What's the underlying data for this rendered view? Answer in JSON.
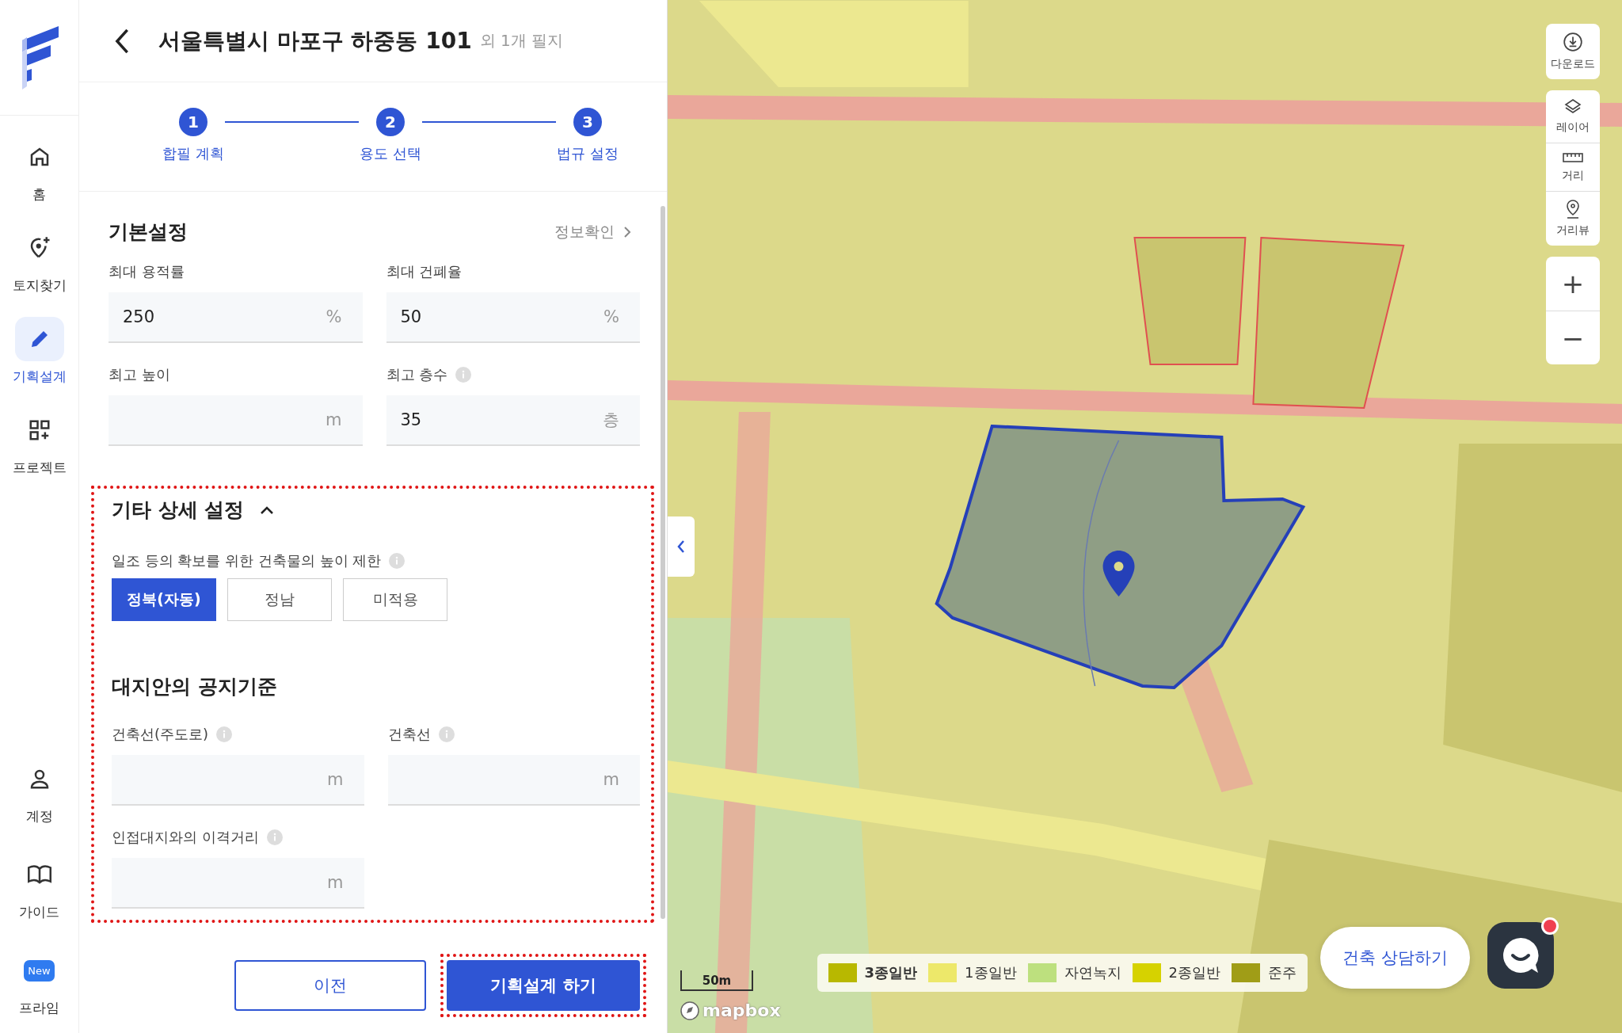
{
  "sidebar": {
    "nav_items": [
      {
        "label": "홈",
        "selected": false
      },
      {
        "label": "토지찾기",
        "selected": false
      },
      {
        "label": "기획설계",
        "selected": true
      },
      {
        "label": "프로젝트",
        "selected": false
      }
    ],
    "bottom_items": [
      {
        "label": "계정"
      },
      {
        "label": "가이드"
      },
      {
        "label": "프라임",
        "badge": "New"
      }
    ]
  },
  "header": {
    "title": "서울특별시 마포구 하중동 101",
    "suffix": "외 1개 필지"
  },
  "stepper": [
    {
      "number": "1",
      "label": "합필 계획"
    },
    {
      "number": "2",
      "label": "용도 선택"
    },
    {
      "number": "3",
      "label": "법규 설정"
    }
  ],
  "basic_settings": {
    "title": "기본설정",
    "link": "정보확인",
    "fields": [
      {
        "label": "최대 용적률",
        "value": "250",
        "unit": "%",
        "info": false
      },
      {
        "label": "최대 건폐율",
        "value": "50",
        "unit": "%",
        "info": false
      },
      {
        "label": "최고 높이",
        "unit": "m",
        "info": false
      },
      {
        "label": "최고 층수",
        "value": "35",
        "unit": "층",
        "info": true
      }
    ]
  },
  "detail_settings": {
    "title": "기타 상세 설정",
    "expanded": true,
    "highlighted": true,
    "sunlight": {
      "label": "일조 등의 확보를 위한 건축물의 높이 제한",
      "info": true,
      "options": [
        {
          "label": "정북(자동)",
          "selected": true
        },
        {
          "label": "정남",
          "selected": false
        },
        {
          "label": "미적용",
          "selected": false
        }
      ]
    },
    "open_space": {
      "title": "대지안의 공지기준",
      "fields": [
        {
          "label": "건축선(주도로)",
          "unit": "m",
          "info": true
        },
        {
          "label": "건축선",
          "unit": "m",
          "info": true
        },
        {
          "label": "인접대지와의 이격거리",
          "unit": "m",
          "info": true
        }
      ]
    }
  },
  "footer": {
    "prev_button": "이전",
    "submit_button": {
      "label": "기획설계 하기",
      "highlighted": true
    }
  },
  "map": {
    "tools": [
      {
        "label": "다운로드"
      },
      {
        "label": "레이어"
      },
      {
        "label": "거리"
      },
      {
        "label": "거리뷰"
      }
    ],
    "zoom_in": "+",
    "zoom_out": "−",
    "scale": "50m",
    "attribution": "mapbox",
    "legend": [
      {
        "label": "3종일반",
        "color": "#b8b800",
        "bold": true
      },
      {
        "label": "1종일반",
        "color": "#ede86a",
        "bold": false
      },
      {
        "label": "자연녹지",
        "color": "#bde07e",
        "bold": false
      },
      {
        "label": "2종일반",
        "color": "#d6d200",
        "bold": false
      },
      {
        "label": "준주",
        "color": "#a09d17",
        "bold": false
      }
    ],
    "consult_button": "건축 상담하기",
    "chat_unread": true
  }
}
